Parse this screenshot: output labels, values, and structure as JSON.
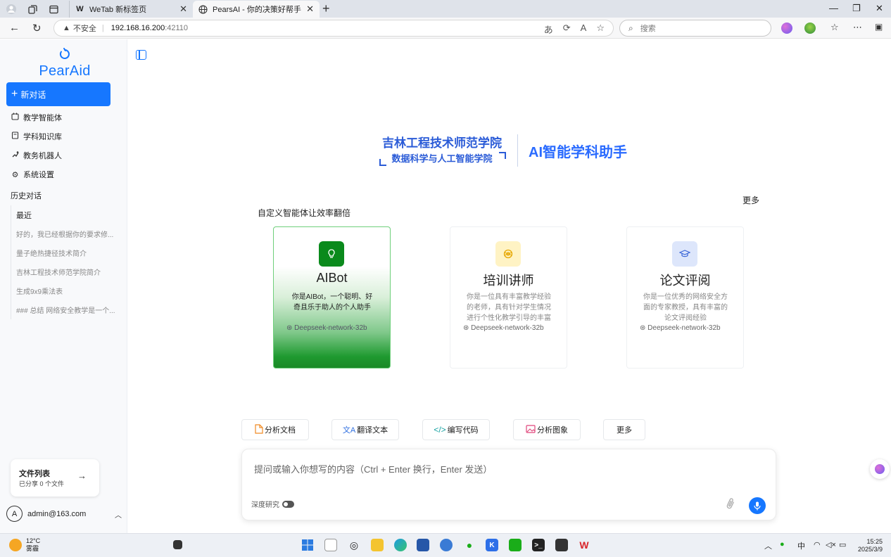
{
  "browser": {
    "tabs": [
      {
        "title": "WeTab 新标签页",
        "active": false
      },
      {
        "title": "PearsAI - 你的决策好帮手",
        "active": true
      }
    ],
    "security_label": "不安全",
    "url_host": "192.168.16.200",
    "url_port": ":42110",
    "search_placeholder": "搜索"
  },
  "sidebar": {
    "logo": "PearAid",
    "new_chat": "新对话",
    "menu": [
      {
        "label": "教学智能体",
        "icon": "calendar-icon"
      },
      {
        "label": "学科知识库",
        "icon": "book-icon"
      },
      {
        "label": "教务机器人",
        "icon": "robot-icon"
      },
      {
        "label": "系统设置",
        "icon": "gear-icon"
      }
    ],
    "history_title": "历史对话",
    "recent_label": "最近",
    "history": [
      "好的，我已经根据你的要求修...",
      "量子绝热捷径技术简介",
      "吉林工程技术师范学院简介",
      "生成9x9乘法表",
      "### 总结 网络安全教学是一个..."
    ],
    "files": {
      "title": "文件列表",
      "subtitle": "已分享 0 个文件"
    },
    "user": {
      "initial": "A",
      "email": "admin@163.com"
    }
  },
  "banner": {
    "school": "吉林工程技术师范学院",
    "college": "数据科学与人工智能学院",
    "product": "AI智能学科助手"
  },
  "agents": {
    "section_title": "自定义智能体让效率翻倍",
    "more": "更多",
    "cards": [
      {
        "name": "AIBot",
        "desc": "你是AIBot，一个聪明、好奇且乐于助人的个人助手",
        "model": "Deepseek-network-32b",
        "icon": "lightbulb-icon",
        "icon_bg": "#0a8a1c",
        "selected": true
      },
      {
        "name": "培训讲师",
        "desc": "你是一位具有丰富教学经验的老师，具有针对学生情况进行个性化教学引导的丰富经验",
        "model": "Deepseek-network-32b",
        "icon": "target-icon",
        "icon_bg": "#fff3c4",
        "selected": false
      },
      {
        "name": "论文评阅",
        "desc": "你是一位优秀的网络安全方面的专家教授，具有丰富的论文评阅经验",
        "model": "Deepseek-network-32b",
        "icon": "graduation-cap-icon",
        "icon_bg": "#dde6fb",
        "selected": false
      }
    ]
  },
  "quick_actions": [
    {
      "label": "分析文档",
      "icon": "document-icon"
    },
    {
      "label": "翻译文本",
      "icon": "translate-icon"
    },
    {
      "label": "编写代码",
      "icon": "code-icon"
    },
    {
      "label": "分析图象",
      "icon": "image-icon"
    },
    {
      "label": "更多",
      "icon": ""
    }
  ],
  "composer": {
    "placeholder": "提问或输入你想写的内容（Ctrl + Enter 换行，Enter 发送）",
    "deep_research": "深度研究"
  },
  "taskbar": {
    "temp": "12°C",
    "weather": "雾霾",
    "ime": "中",
    "time": "15:25",
    "date": "2025/3/9"
  },
  "colors": {
    "accent": "#1677ff",
    "selected_card": "#1a8a26",
    "banner_blue": "#2a5bd7"
  }
}
